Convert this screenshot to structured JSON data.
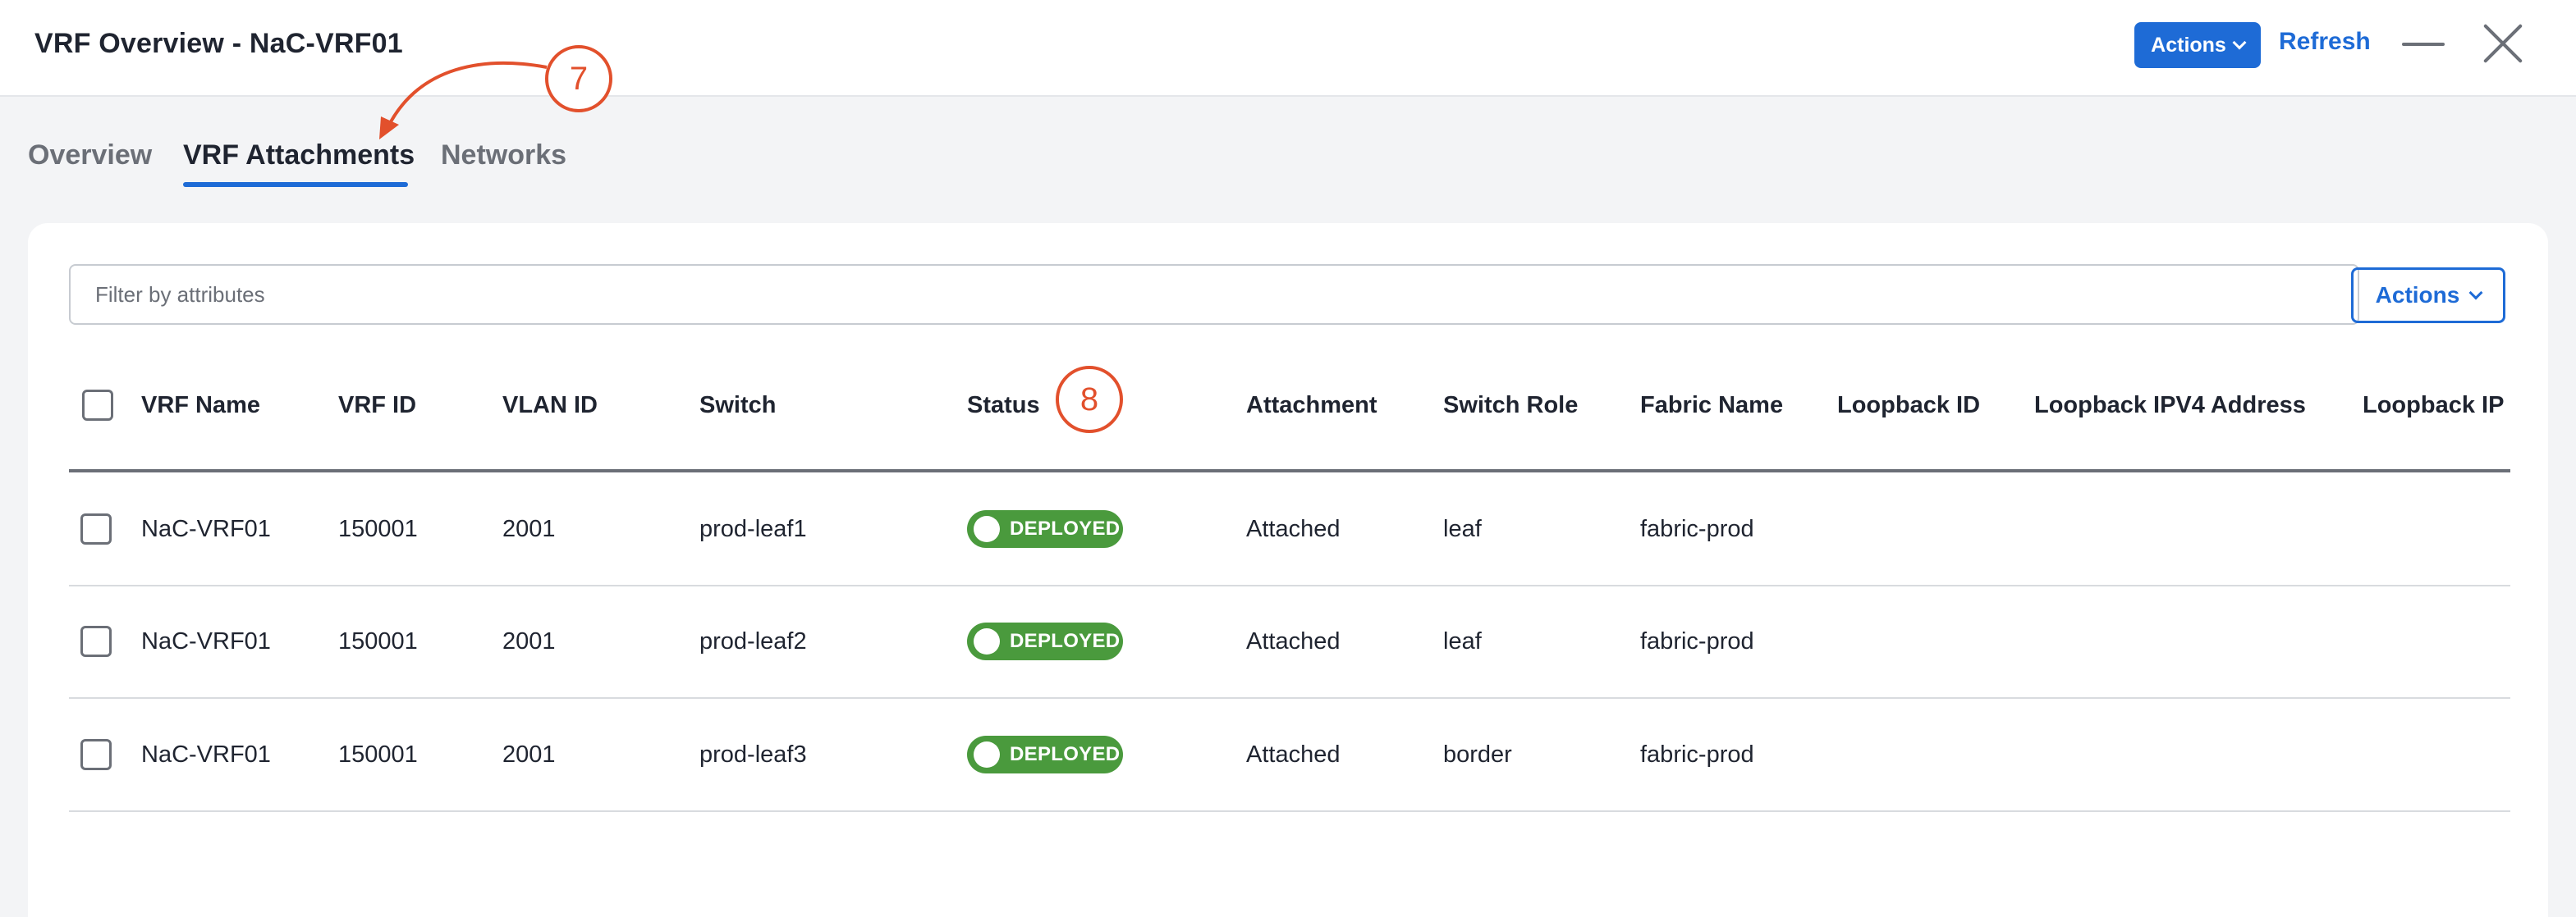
{
  "header": {
    "title": "VRF Overview - NaC-VRF01",
    "actions_label": "Actions",
    "refresh_label": "Refresh"
  },
  "tabs": [
    {
      "label": "Overview",
      "active": false
    },
    {
      "label": "VRF Attachments",
      "active": true
    },
    {
      "label": "Networks",
      "active": false
    }
  ],
  "callouts": {
    "tab_callout": "7",
    "status_callout": "8"
  },
  "toolbar": {
    "filter_placeholder": "Filter by attributes",
    "filter_value": "",
    "actions_label": "Actions"
  },
  "table": {
    "columns": [
      "VRF Name",
      "VRF ID",
      "VLAN ID",
      "Switch",
      "Status",
      "Attachment",
      "Switch Role",
      "Fabric Name",
      "Loopback ID",
      "Loopback IPV4 Address",
      "Loopback IPV"
    ],
    "rows": [
      {
        "vrf_name": "NaC-VRF01",
        "vrf_id": "150001",
        "vlan_id": "2001",
        "switch": "prod-leaf1",
        "status": "DEPLOYED",
        "attachment": "Attached",
        "switch_role": "leaf",
        "fabric_name": "fabric-prod",
        "loopback_id": "",
        "loopback_ipv4": "",
        "loopback_ipv6": ""
      },
      {
        "vrf_name": "NaC-VRF01",
        "vrf_id": "150001",
        "vlan_id": "2001",
        "switch": "prod-leaf2",
        "status": "DEPLOYED",
        "attachment": "Attached",
        "switch_role": "leaf",
        "fabric_name": "fabric-prod",
        "loopback_id": "",
        "loopback_ipv4": "",
        "loopback_ipv6": ""
      },
      {
        "vrf_name": "NaC-VRF01",
        "vrf_id": "150001",
        "vlan_id": "2001",
        "switch": "prod-leaf3",
        "status": "DEPLOYED",
        "attachment": "Attached",
        "switch_role": "border",
        "fabric_name": "fabric-prod",
        "loopback_id": "",
        "loopback_ipv4": "",
        "loopback_ipv6": ""
      }
    ]
  },
  "colors": {
    "accent": "#1e6bd6",
    "deployed": "#4a9a3d",
    "callout": "#e2502c"
  },
  "icons": {
    "minimize": "minimize-icon",
    "close": "close-icon",
    "chevron": "chevron-down-icon"
  }
}
